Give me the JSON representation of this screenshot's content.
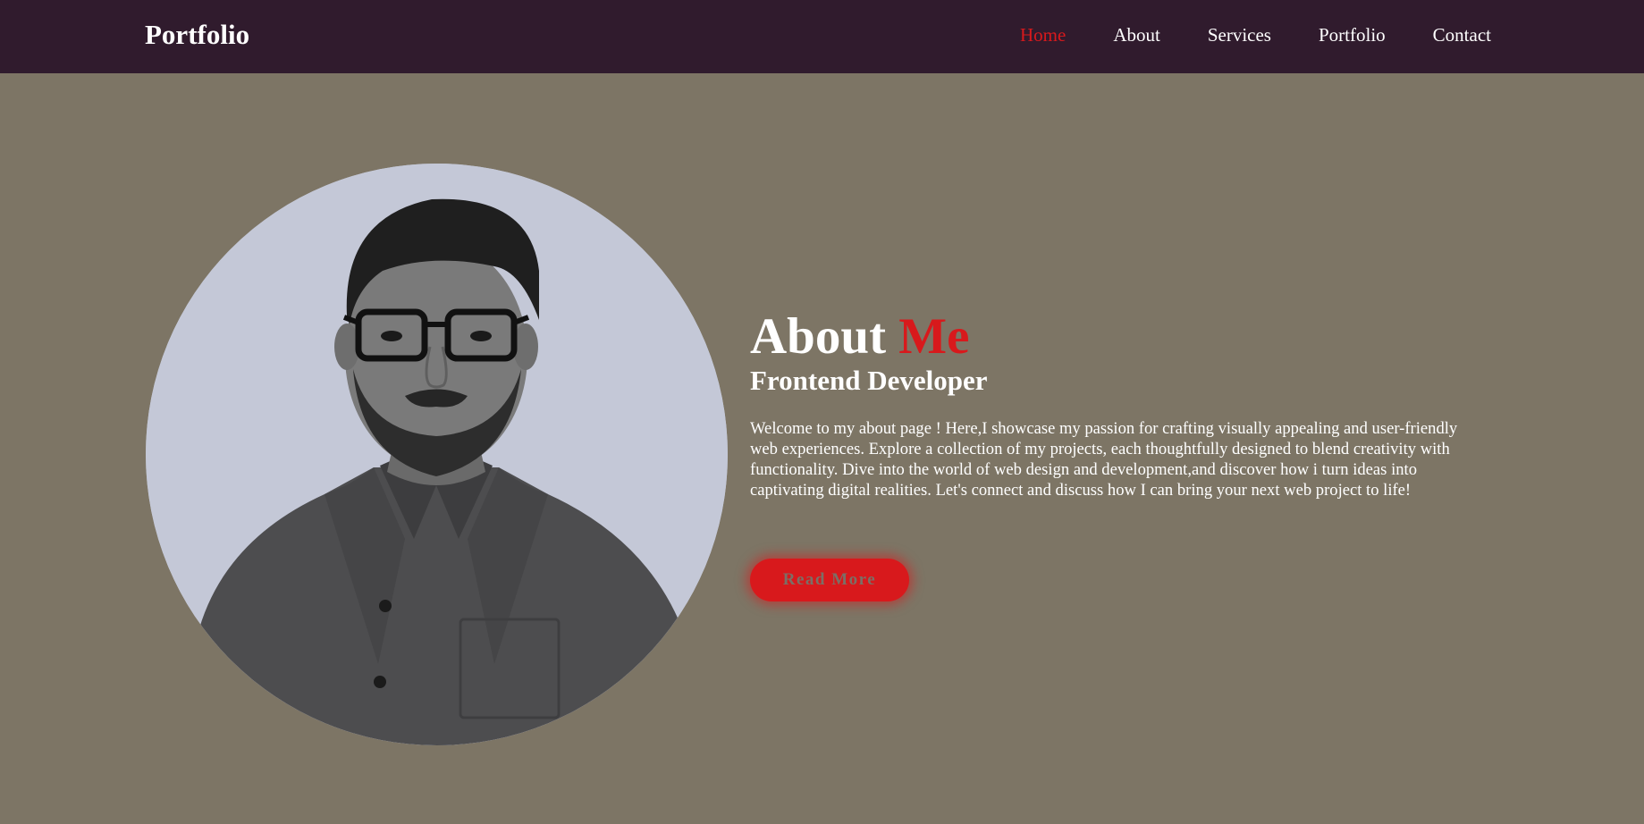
{
  "header": {
    "logo": "Portfolio",
    "nav": [
      {
        "label": "Home",
        "active": true
      },
      {
        "label": "About",
        "active": false
      },
      {
        "label": "Services",
        "active": false
      },
      {
        "label": "Portfolio",
        "active": false
      },
      {
        "label": "Contact",
        "active": false
      }
    ]
  },
  "about": {
    "title_main": "About ",
    "title_accent": "Me",
    "subtitle": "Frontend Developer",
    "body": "Welcome to my about page ! Here,I showcase my passion for crafting visually appealing and user-friendly web experiences. Explore a collection of my projects, each thoughtfully designed to blend creativity with functionality. Dive into the world of web design and development,and discover how i turn ideas into captivating digital realities. Let's connect and discuss how I can bring your next web project to life!",
    "button_label": "Read More"
  },
  "colors": {
    "header_bg": "#301b2d",
    "page_bg": "#7d7565",
    "accent": "#d8191c",
    "photo_bg": "#c4c8d7"
  },
  "icons": {
    "profile_photo": "profile-photo"
  }
}
